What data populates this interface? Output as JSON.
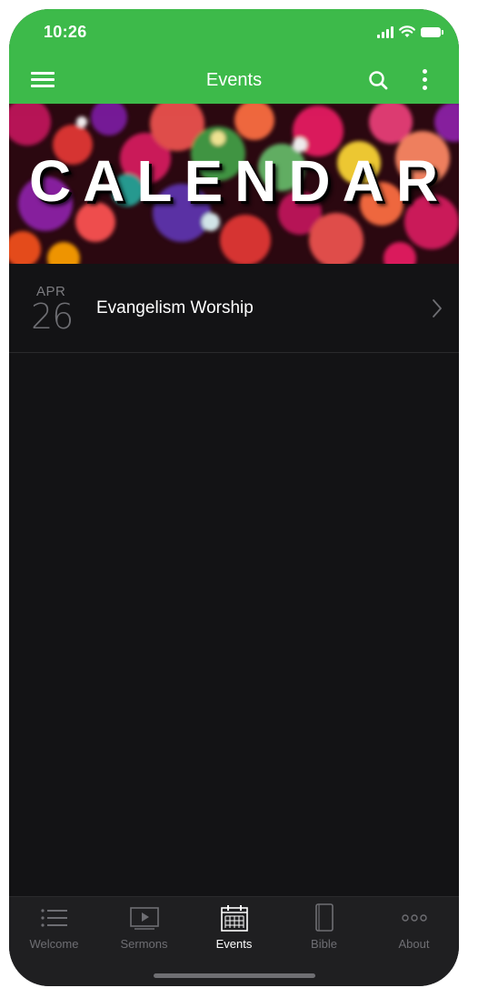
{
  "status_bar": {
    "time": "10:26"
  },
  "header": {
    "title": "Events",
    "background_color": "#3dba4a",
    "menu_icon": "hamburger-menu-icon",
    "search_icon": "search-icon",
    "more_icon": "more-vertical-icon"
  },
  "banner": {
    "text": "CALENDAR"
  },
  "events": [
    {
      "month": "APR",
      "day": "26",
      "title": "Evangelism Worship"
    }
  ],
  "tab_bar": {
    "tabs": [
      {
        "label": "Welcome",
        "icon": "list-icon",
        "active": false
      },
      {
        "label": "Sermons",
        "icon": "play-video-icon",
        "active": false
      },
      {
        "label": "Events",
        "icon": "calendar-icon",
        "active": true
      },
      {
        "label": "Bible",
        "icon": "book-icon",
        "active": false
      },
      {
        "label": "About",
        "icon": "dots-icon",
        "active": false
      }
    ]
  },
  "colors": {
    "accent": "#3dba4a",
    "background": "#131315",
    "tab_bar": "#1f1f21",
    "inactive": "#6e6e73"
  }
}
